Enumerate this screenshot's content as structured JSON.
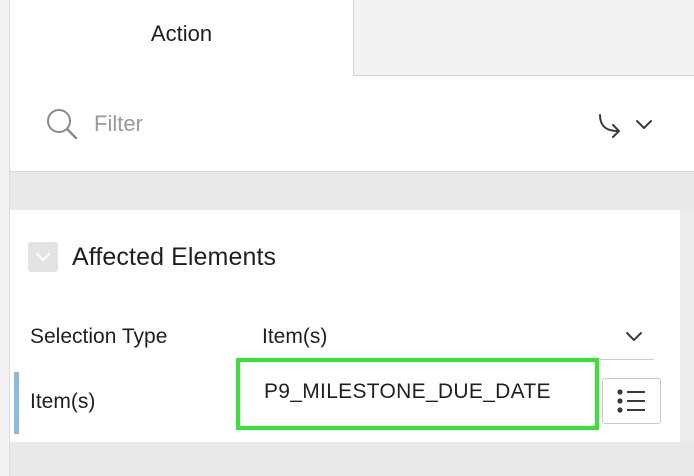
{
  "tabs": {
    "action_label": "Action"
  },
  "filter": {
    "placeholder": "Filter",
    "value": ""
  },
  "icons": {
    "search": "search-icon",
    "goto": "go-to-arrow-icon",
    "dropdown": "chevron-down-icon",
    "collapse": "chevron-down-icon",
    "list": "list-icon"
  },
  "section": {
    "title": "Affected Elements",
    "selection_type": {
      "label": "Selection Type",
      "value": "Item(s)"
    },
    "items": {
      "label": "Item(s)",
      "value": "P9_MILESTONE_DUE_DATE"
    }
  },
  "colors": {
    "highlight_border": "#33e633",
    "active_bar": "#8ab9e2"
  }
}
